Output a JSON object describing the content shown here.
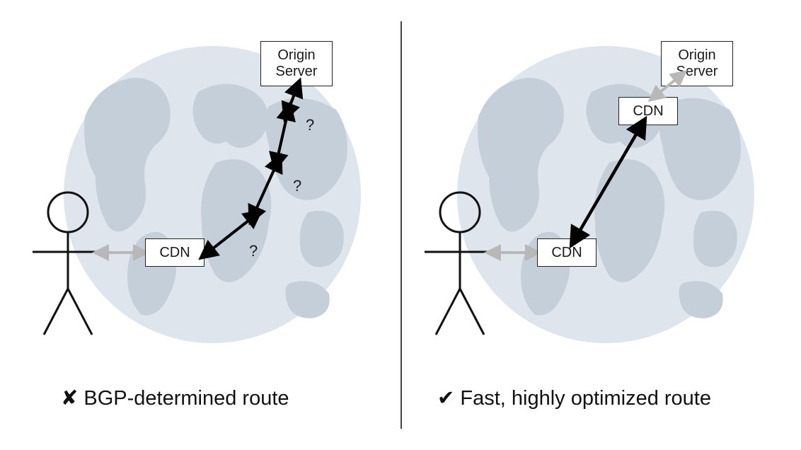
{
  "diagram": {
    "left": {
      "origin_label": "Origin\nServer",
      "cdn_label": "CDN",
      "question_marks": [
        "?",
        "?",
        "?"
      ],
      "caption_icon": "✘",
      "caption_text": "BGP-determined route"
    },
    "right": {
      "origin_label": "Origin\nServer",
      "cdn_top_label": "CDN",
      "cdn_bottom_label": "CDN",
      "caption_icon": "✔",
      "caption_text": "Fast, highly optimized route"
    }
  }
}
